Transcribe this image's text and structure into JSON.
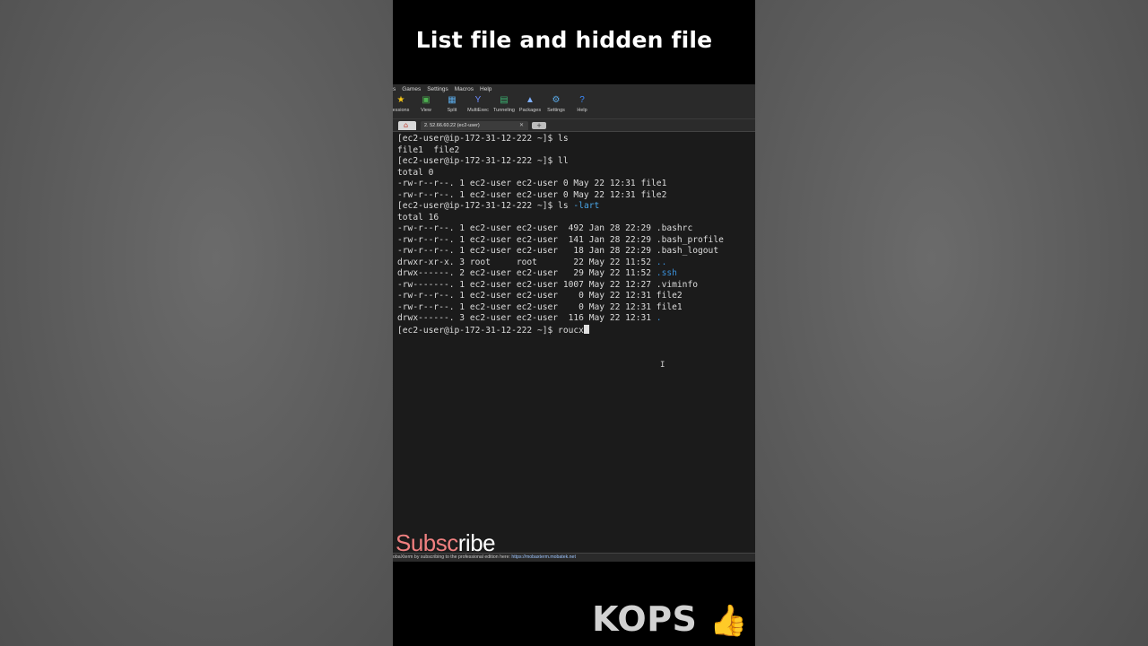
{
  "video": {
    "title": "List file and hidden file",
    "subscribe_part1": "Subsc",
    "subscribe_part2": "ribe",
    "brand": "KOPS",
    "brand_icon": "thumbs-up-icon"
  },
  "app": {
    "menu": [
      "s",
      "Games",
      "Settings",
      "Macros",
      "Help"
    ],
    "toolbar": [
      {
        "label": "essions",
        "icon": "star-icon",
        "glyph": "★",
        "color": "#f5c518"
      },
      {
        "label": "View",
        "icon": "monitor-icon",
        "glyph": "▣",
        "color": "#4caf50"
      },
      {
        "label": "Split",
        "icon": "split-icon",
        "glyph": "▦",
        "color": "#5aa9e6"
      },
      {
        "label": "MultiExec",
        "icon": "fork-icon",
        "glyph": "Y",
        "color": "#6c8cff"
      },
      {
        "label": "Tunneling",
        "icon": "tunnel-icon",
        "glyph": "▤",
        "color": "#3cb371"
      },
      {
        "label": "Packages",
        "icon": "package-icon",
        "glyph": "▲",
        "color": "#7fb0ff"
      },
      {
        "label": "Settings",
        "icon": "gear-icon",
        "glyph": "⚙",
        "color": "#5aa9e6"
      },
      {
        "label": "Help",
        "icon": "help-icon",
        "glyph": "?",
        "color": "#3d8bfd"
      }
    ],
    "session_tab": "2. 52.66.60.22 (ec2-user)",
    "status_text": "obaXterm by subscribing to the professional edition here:",
    "status_link": "https://mobaxterm.mobatek.net"
  },
  "terminal": {
    "lines": [
      [
        {
          "t": "[ec2-user@ip-172-31-12-222 ~]$ ls"
        }
      ],
      [
        {
          "t": "file1  file2"
        }
      ],
      [
        {
          "t": "[ec2-user@ip-172-31-12-222 ~]$ ll"
        }
      ],
      [
        {
          "t": "total 0"
        }
      ],
      [
        {
          "t": "-rw-r--r--. 1 ec2-user ec2-user 0 May 22 12:31 file1"
        }
      ],
      [
        {
          "t": "-rw-r--r--. 1 ec2-user ec2-user 0 May 22 12:31 file2"
        }
      ],
      [
        {
          "t": "[ec2-user@ip-172-31-12-222 ~]$ ls "
        },
        {
          "t": "-lart",
          "c": "cmd"
        }
      ],
      [
        {
          "t": "total 16"
        }
      ],
      [
        {
          "t": "-rw-r--r--. 1 ec2-user ec2-user  492 Jan 28 22:29 .bashrc"
        }
      ],
      [
        {
          "t": "-rw-r--r--. 1 ec2-user ec2-user  141 Jan 28 22:29 .bash_profile"
        }
      ],
      [
        {
          "t": "-rw-r--r--. 1 ec2-user ec2-user   18 Jan 28 22:29 .bash_logout"
        }
      ],
      [
        {
          "t": "drwxr-xr-x. 3 root     root       22 May 22 11:52 "
        },
        {
          "t": "..",
          "c": "dir"
        }
      ],
      [
        {
          "t": "drwx------. 2 ec2-user ec2-user   29 May 22 11:52 "
        },
        {
          "t": ".ssh",
          "c": "dir"
        }
      ],
      [
        {
          "t": "-rw-------. 1 ec2-user ec2-user 1007 May 22 12:27 .viminfo"
        }
      ],
      [
        {
          "t": "-rw-r--r--. 1 ec2-user ec2-user    0 May 22 12:31 file2"
        }
      ],
      [
        {
          "t": "-rw-r--r--. 1 ec2-user ec2-user    0 May 22 12:31 file1"
        }
      ],
      [
        {
          "t": "drwx------. 3 ec2-user ec2-user  116 May 22 12:31 "
        },
        {
          "t": ".",
          "c": "dir"
        }
      ],
      [
        {
          "t": "[ec2-user@ip-172-31-12-222 ~]$ roucx"
        },
        {
          "cursor": true
        }
      ]
    ]
  }
}
